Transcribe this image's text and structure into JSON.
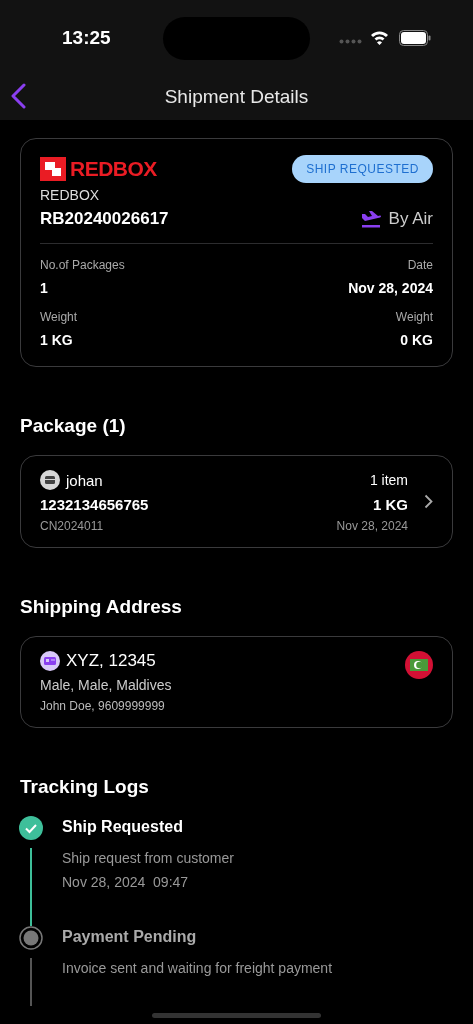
{
  "status_bar": {
    "time": "13:25"
  },
  "nav": {
    "title": "Shipment Details"
  },
  "shipment": {
    "logo": "REDBOX",
    "carrier": "REDBOX",
    "tracking_number": "RB20240026617",
    "status": "SHIP REQUESTED",
    "mode": "By Air",
    "fields": [
      {
        "label": "No.of Packages",
        "value": "1"
      },
      {
        "label": "Date",
        "value": "Nov 28, 2024"
      },
      {
        "label": "Weight",
        "value": "1 KG"
      },
      {
        "label": "Weight",
        "value": "0 KG"
      }
    ]
  },
  "package_section": {
    "title": "Package (1)",
    "packages": [
      {
        "name": "johan",
        "items": "1 item",
        "number": "1232134656765",
        "weight": "1 KG",
        "code": "CN2024011",
        "date": "Nov 28, 2024"
      }
    ]
  },
  "address_section": {
    "title": "Shipping Address",
    "address": {
      "line1": "XYZ, 12345",
      "line2": "Male, Male, Maldives",
      "contact": "John Doe, 9609999999"
    }
  },
  "tracking_section": {
    "title": "Tracking Logs",
    "logs": [
      {
        "title": "Ship Requested",
        "done": true,
        "description": "Ship request from customer",
        "date": "Nov 28, 2024",
        "time": "09:47"
      },
      {
        "title": "Payment Pending",
        "done": false,
        "description": "Invoice sent and waiting for freight payment"
      }
    ]
  }
}
